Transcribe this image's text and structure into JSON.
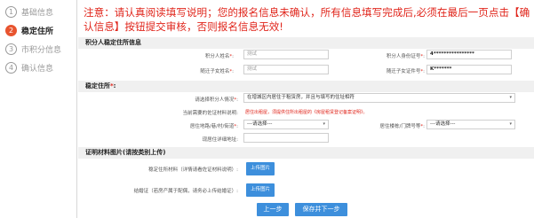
{
  "steps": [
    {
      "num": "1",
      "label": "基础信息"
    },
    {
      "num": "2",
      "label": "稳定住所"
    },
    {
      "num": "3",
      "label": "市积分信息"
    },
    {
      "num": "4",
      "label": "确认信息"
    }
  ],
  "notice": "注意：请认真阅读填写说明；您的报名信息未确认，所有信息填写完成后,必须在最后一页点击【确认信息】按钮提交审核，否则报名信息无效!",
  "applicant": {
    "section_title": "积分人稳定住所信息",
    "name_label": "积分人姓名",
    "name_value": "测试",
    "id_label": "积分人身份证号",
    "id_value": "4****************",
    "child_name_label": "随迁子女姓名",
    "child_name_value": "测试",
    "child_id_label": "随迁子女证件号",
    "child_id_value": "K*******"
  },
  "residence": {
    "section_title": "稳定住所",
    "situation_label": "请选择积分人情况",
    "situation_value": "在增城区内居住于租赁房，并且与填写的住址相符",
    "proof_label": "当前需要的佐证材料说明",
    "proof_hint": "居住出租屋，须提供住所出租屋的《房屋租赁登记备案证明》。",
    "area_label": "居住地路/巷/村/街道",
    "area_value": "---请选择---",
    "building_label": "居住楼栋/门牌号等",
    "building_value": "---请选择---",
    "detail_label": "现居住详细地址"
  },
  "materials": {
    "section_title": "证明材料图片(请按类别上传)",
    "proof_material_label": "稳定住所材料（详情请看佐证材料说明）",
    "proof_upload": "上传图片",
    "marriage_label": "结婚证（若房产属于配偶，请务必上传结婚证）",
    "marriage_upload": "上传图片"
  },
  "nav": {
    "prev": "上一步",
    "next": "保存并下一步"
  }
}
